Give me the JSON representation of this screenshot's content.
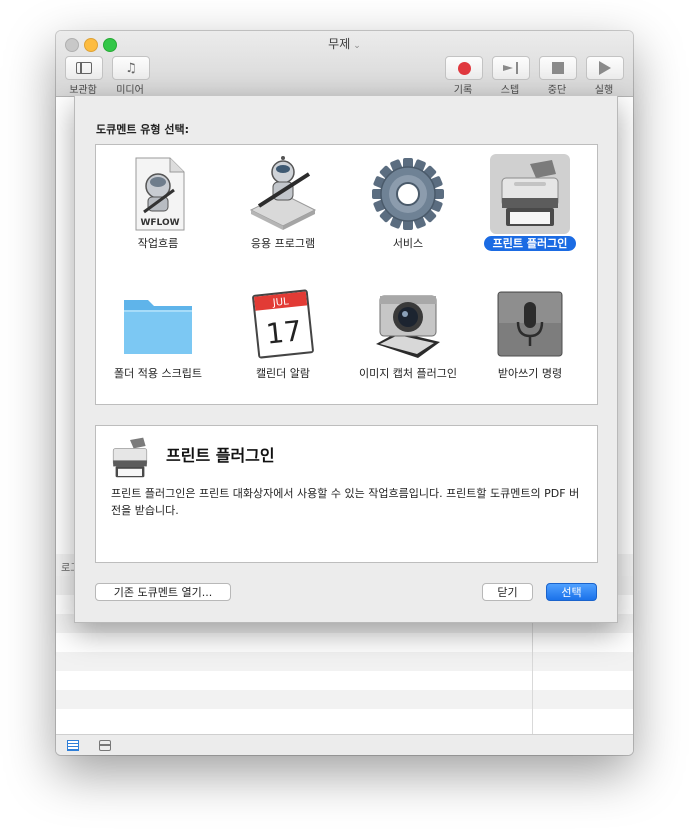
{
  "window": {
    "title": "무제",
    "toolbar": {
      "library_label": "보관함",
      "media_label": "미디어",
      "record_label": "기록",
      "step_label": "스텝",
      "stop_label": "중단",
      "run_label": "실행"
    },
    "log_header": "로그"
  },
  "sheet": {
    "heading": "도큐멘트 유형 선택:",
    "types": [
      {
        "label": "작업흐름",
        "icon": "workflow-document-icon"
      },
      {
        "label": "응용 프로그램",
        "icon": "automator-robot-icon"
      },
      {
        "label": "서비스",
        "icon": "gear-icon"
      },
      {
        "label": "프린트 플러그인",
        "icon": "printer-icon",
        "selected": true
      },
      {
        "label": "폴더 적용 스크립트",
        "icon": "folder-icon"
      },
      {
        "label": "캘린더 알람",
        "icon": "calendar-icon"
      },
      {
        "label": "이미지 캡처 플러그인",
        "icon": "camera-icon"
      },
      {
        "label": "받아쓰기 명령",
        "icon": "microphone-icon"
      }
    ],
    "workflow_badge": "WFLOW",
    "calendar_month": "JUL",
    "calendar_day": "17",
    "description": {
      "title": "프린트 플러그인",
      "text": "프린트 플러그인은 프린트 대화상자에서 사용할 수 있는 작업흐름입니다. 프린트할 도큐멘트의 PDF 버전을 받습니다."
    },
    "buttons": {
      "open_existing": "기존 도큐멘트 열기...",
      "close": "닫기",
      "choose": "선택"
    }
  },
  "colors": {
    "accent": "#1b6be3",
    "record": "#e0383e"
  }
}
